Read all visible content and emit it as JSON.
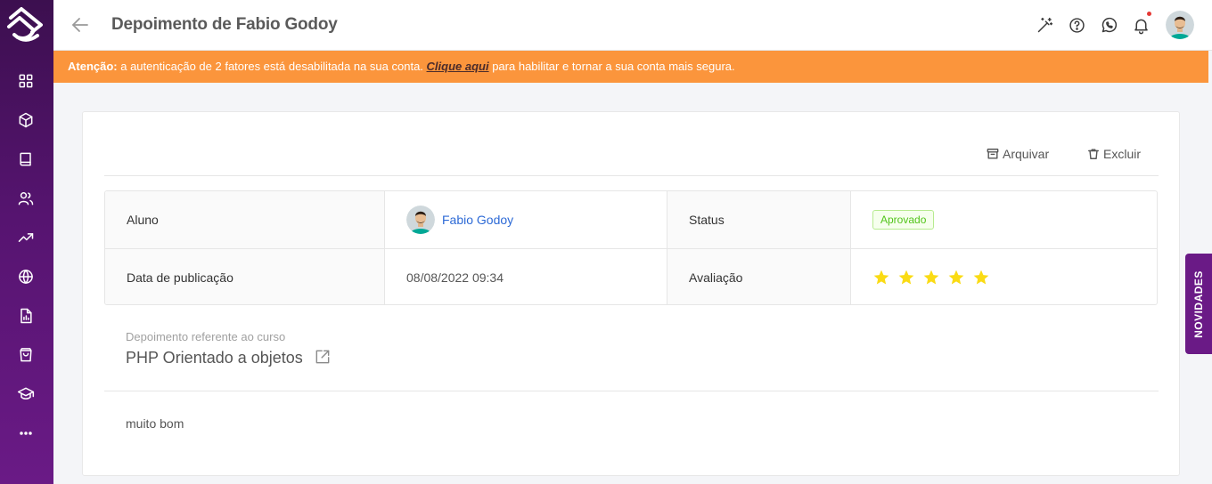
{
  "header": {
    "title": "Depoimento de Fabio Godoy"
  },
  "warning": {
    "prefix": "Atenção:",
    "text_before": " a autenticação de 2 fatores está desabilitada na sua conta. ",
    "link": "Clique aqui",
    "text_after": " para habilitar e tornar a sua conta mais segura."
  },
  "actions": {
    "archive": "Arquivar",
    "delete": "Excluir"
  },
  "details": {
    "student_label": "Aluno",
    "student_name": "Fabio Godoy",
    "status_label": "Status",
    "status_value": "Aprovado",
    "published_label": "Data de publicação",
    "published_value": "08/08/2022 09:34",
    "rating_label": "Avaliação",
    "rating_value": 5,
    "rating_max": 5
  },
  "course": {
    "caption": "Depoimento referente ao curso",
    "name": "PHP Orientado a objetos"
  },
  "testimonial": {
    "text": "muito bom"
  },
  "side_tab": {
    "label": "NOVIDADES"
  },
  "colors": {
    "sidebar": "#561470",
    "warning": "#fb953c",
    "link": "#2d6ad6",
    "star": "#fadb14",
    "status_badge": "#52c41a"
  }
}
